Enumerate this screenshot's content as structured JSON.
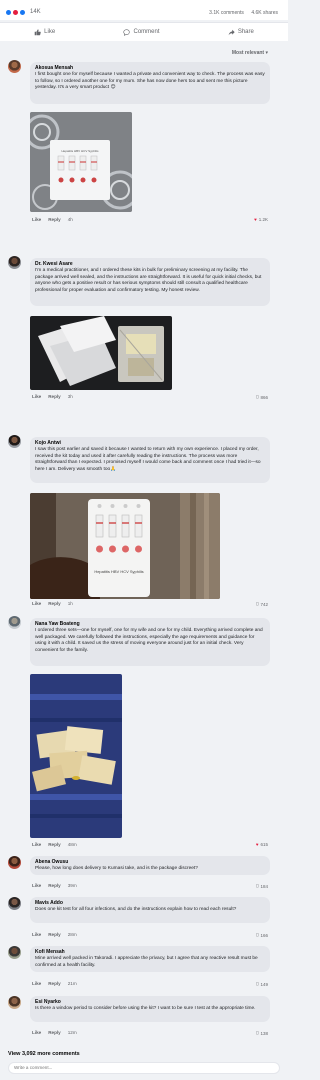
{
  "header": {
    "reaction_count": "14K",
    "comments_count": "3.1K comments",
    "shares_count": "4.6K shares",
    "like_label": "Like",
    "comment_label": "Comment",
    "share_label": "Share",
    "sort_label": "Most relevant"
  },
  "colors": {
    "accent": "#1877f2",
    "like_red": "#e41e3f",
    "bubble": "#e4e6eb"
  },
  "comments": [
    {
      "name": "Akosua Mensah",
      "text": "I first bought one for myself because I wanted a private and convenient way to check. The process was easy to follow, so I ordered another one for my mum. She has now done hers too and sent me this picture yesterday. It's a very smart product 😊",
      "like": "Like",
      "reply": "Reply",
      "time": "4h",
      "count": "1.2K"
    },
    {
      "name": "Dr. Kwesi Asare",
      "text": "I'm a medical practitioner, and I ordered these kits in bulk for preliminary screening at my facility. The package arrived well sealed, and the instructions are straightforward. It is useful for quick initial checks, but anyone who gets a positive result or has serious symptoms should still consult a qualified healthcare professional for proper evaluation and confirmatory testing. My honest review.",
      "like": "Like",
      "reply": "Reply",
      "time": "3h",
      "count": "866"
    },
    {
      "name": "Kojo Antwi",
      "text": "I saw this post earlier and saved it because I wanted to return with my own experience. I placed my order, received the kit today and used it after carefully reading the instructions. The process was more straightforward than I expected. I promised myself I would come back and comment once I had tried it—so here I am. Delivery was smooth too🙏",
      "like": "Like",
      "reply": "Reply",
      "time": "1h",
      "count": "742"
    },
    {
      "name": "Nana Yaw Boateng",
      "text": "I ordered three sets—one for myself, one for my wife and one for my child. Everything arrived complete and well packaged. We carefully followed the instructions, especially the age requirements and guidance for using it with a child. It saved us the stress of moving everyone around just for an initial check. Very convenient for the family.",
      "like": "Like",
      "reply": "Reply",
      "time": "48m",
      "count": "615"
    },
    {
      "name": "Abena Owusu",
      "text": "Please, how long does delivery to Kumasi take, and is the package discreet?",
      "like": "Like",
      "reply": "Reply",
      "time": "39m",
      "count": "184"
    },
    {
      "name": "Mavis Addo",
      "text": "Does one kit test for all four infections, and do the instructions explain how to read each result?",
      "like": "Like",
      "reply": "Reply",
      "time": "28m",
      "count": "166"
    },
    {
      "name": "Kofi Mensah",
      "text": "Mine arrived well packed in Takoradi. I appreciate the privacy, but I agree that any reactive result must be confirmed at a health facility.",
      "like": "Like",
      "reply": "Reply",
      "time": "21m",
      "count": "149"
    },
    {
      "name": "Esi Nyarko",
      "text": "Is there a window period to consider before using the kit? I want to be sure I test at the appropriate time.",
      "like": "Like",
      "reply": "Reply",
      "time": "12m",
      "count": "138"
    }
  ],
  "photos": {
    "kit_labels": "Hepatitis HBV HCV Syphilis",
    "kit_labels_2": "Hepatitis HBV HCV Syphilis"
  },
  "footer": {
    "view_more": "View 3,092 more comments",
    "write_placeholder": "Write a comment..."
  }
}
